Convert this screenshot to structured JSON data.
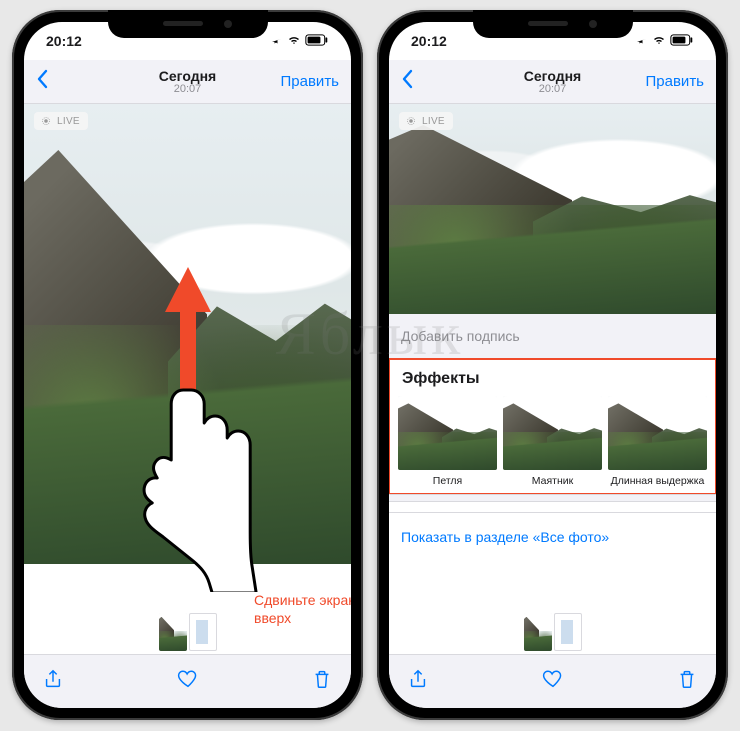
{
  "watermark": "Яблык",
  "status": {
    "time": "20:12"
  },
  "nav": {
    "title": "Сегодня",
    "subtitle": "20:07",
    "edit": "Править"
  },
  "live_badge": "LIVE",
  "left": {
    "hint": "Сдвиньте экран вверх"
  },
  "right": {
    "caption_placeholder": "Добавить подпись",
    "effects_heading": "Эффекты",
    "effects": [
      {
        "label": "Петля"
      },
      {
        "label": "Маятник"
      },
      {
        "label": "Длинная выдержка"
      }
    ],
    "show_all": "Показать в разделе «Все фото»"
  }
}
